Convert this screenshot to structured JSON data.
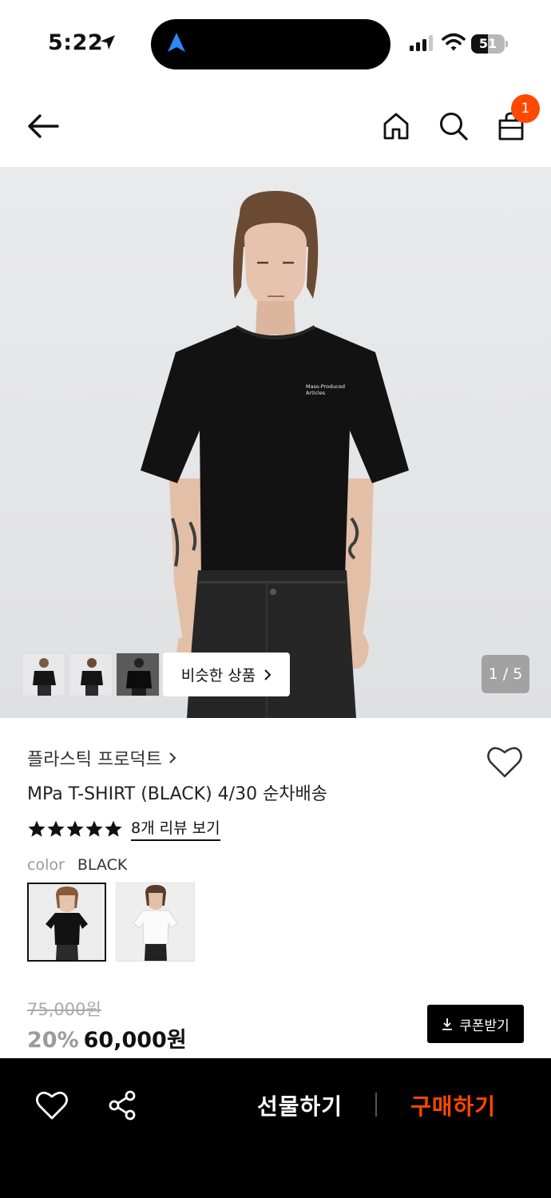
{
  "status_bar": {
    "time": "5:22",
    "battery_percent": "51",
    "battery_level": 0.51
  },
  "nav": {
    "cart_count": "1",
    "icons": [
      "back-arrow-icon",
      "home-icon",
      "search-icon",
      "shopping-bag-icon"
    ]
  },
  "gallery": {
    "similar_label": "비슷한 상품",
    "page_indicator": "1 / 5"
  },
  "product": {
    "brand": "플라스틱 프로덕트",
    "title": "MPa T-SHIRT (BLACK) 4/30 순차배송",
    "rating_stars": 5,
    "review_link": "8개 리뷰 보기",
    "color_label": "color",
    "color_value": "BLACK",
    "original_price": "75,000원",
    "discount": "20%",
    "price": "60,000원",
    "coupon_label": "쿠폰받기",
    "shirt_print": "Mass-Produced Articles"
  },
  "bottom_bar": {
    "gift_label": "선물하기",
    "buy_label": "구매하기"
  },
  "colors": {
    "accent": "#ff4800",
    "bottom_bar_bg": "#000000",
    "discount_text": "#9b9b9b"
  }
}
